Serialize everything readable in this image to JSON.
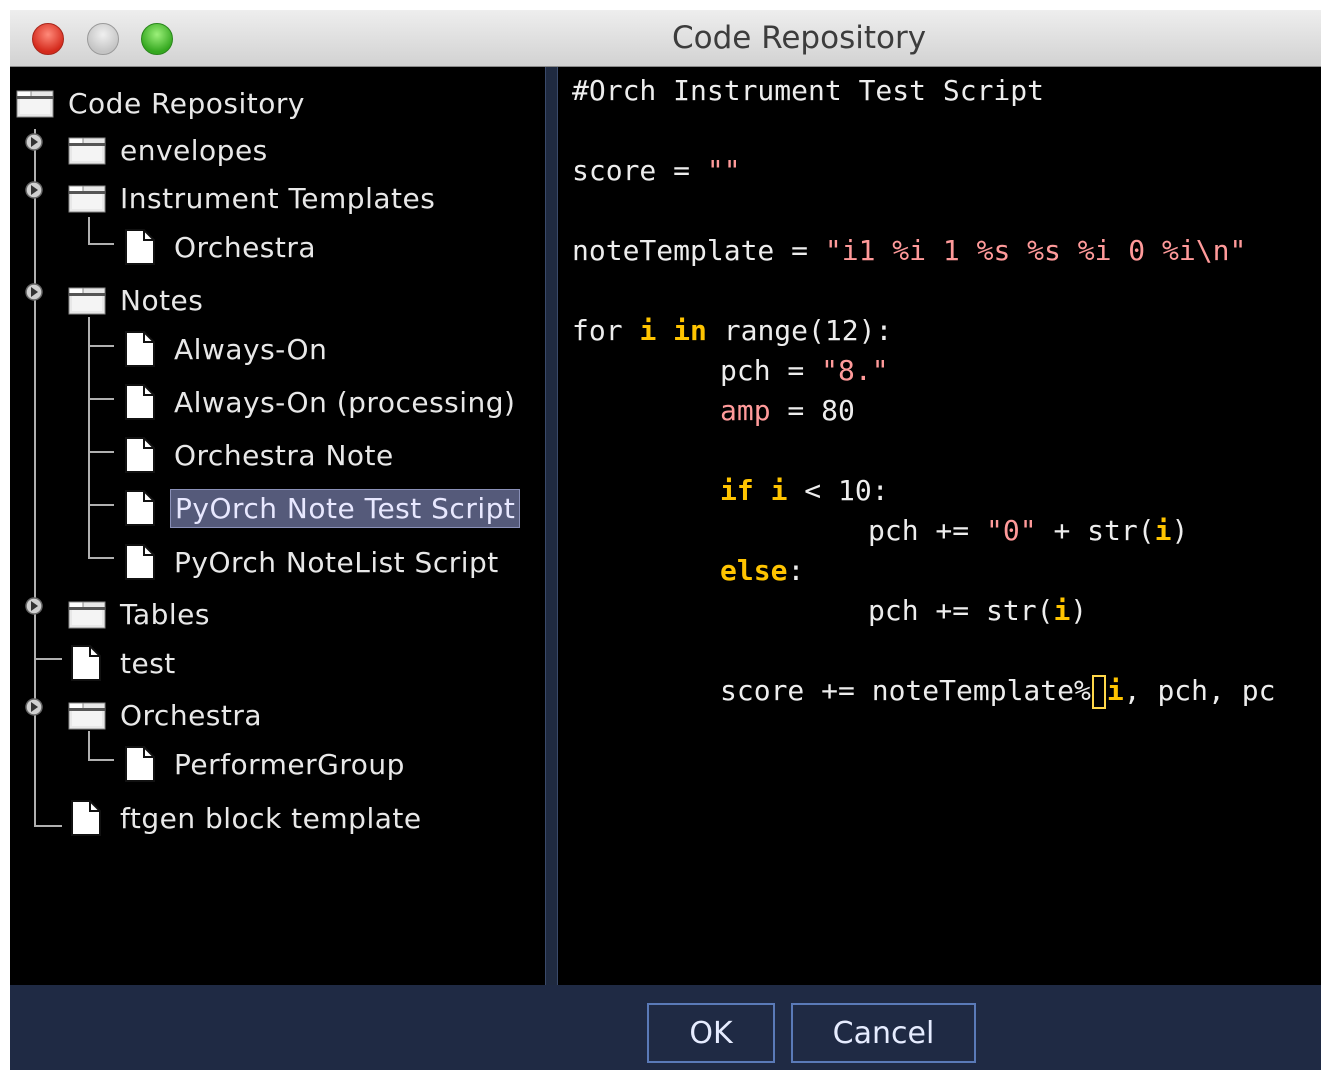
{
  "window": {
    "title": "Code Repository"
  },
  "tree": {
    "root": "Code Repository",
    "envelopes": "envelopes",
    "instrument_templates": "Instrument Templates",
    "orchestra_child": "Orchestra",
    "notes": "Notes",
    "always_on": "Always-On",
    "always_on_processing": "Always-On (processing)",
    "orchestra_note": "Orchestra Note",
    "pyorch_note_test_script": "PyOrch Note Test Script",
    "pyorch_notelist_script": "PyOrch NoteList Script",
    "tables": "Tables",
    "test": "test",
    "orchestra": "Orchestra",
    "performer_group": "PerformerGroup",
    "ftgen_block_template": "ftgen block template",
    "selected": "PyOrch Note Test Script"
  },
  "code": {
    "line1": "#Orch Instrument Test Script",
    "line2_a": "score = ",
    "line2_b": "\"\"",
    "line3_a": "noteTemplate = ",
    "line3_b": "\"i1 %i 1 %s %s %i 0 %i\\n\"",
    "line4_a": "for ",
    "line4_b": "i",
    "line4_c": " ",
    "line4_d": "in",
    "line4_e": " range(12):",
    "line5_a": "pch = ",
    "line5_b": "\"8.\"",
    "line6_a": "amp",
    "line6_b": " = 80",
    "line7_a": "if",
    "line7_b": " ",
    "line7_c": "i",
    "line7_d": " < 10:",
    "line8_a": "pch += ",
    "line8_b": "\"0\"",
    "line8_c": " + str(",
    "line8_d": "i",
    "line8_e": ")",
    "line9_a": "else",
    "line9_b": ":",
    "line10_a": "pch += str(",
    "line10_b": "i",
    "line10_c": ")",
    "line11_a": "score += noteTemplate%",
    "line11_b": "i",
    "line11_c": ", pch, pc"
  },
  "buttons": {
    "ok": "OK",
    "cancel": "Cancel"
  },
  "colors": {
    "keyword": "#ffc400",
    "string": "#ff9a9a",
    "selection": "#555a7a",
    "panel": "#1f2a44"
  }
}
